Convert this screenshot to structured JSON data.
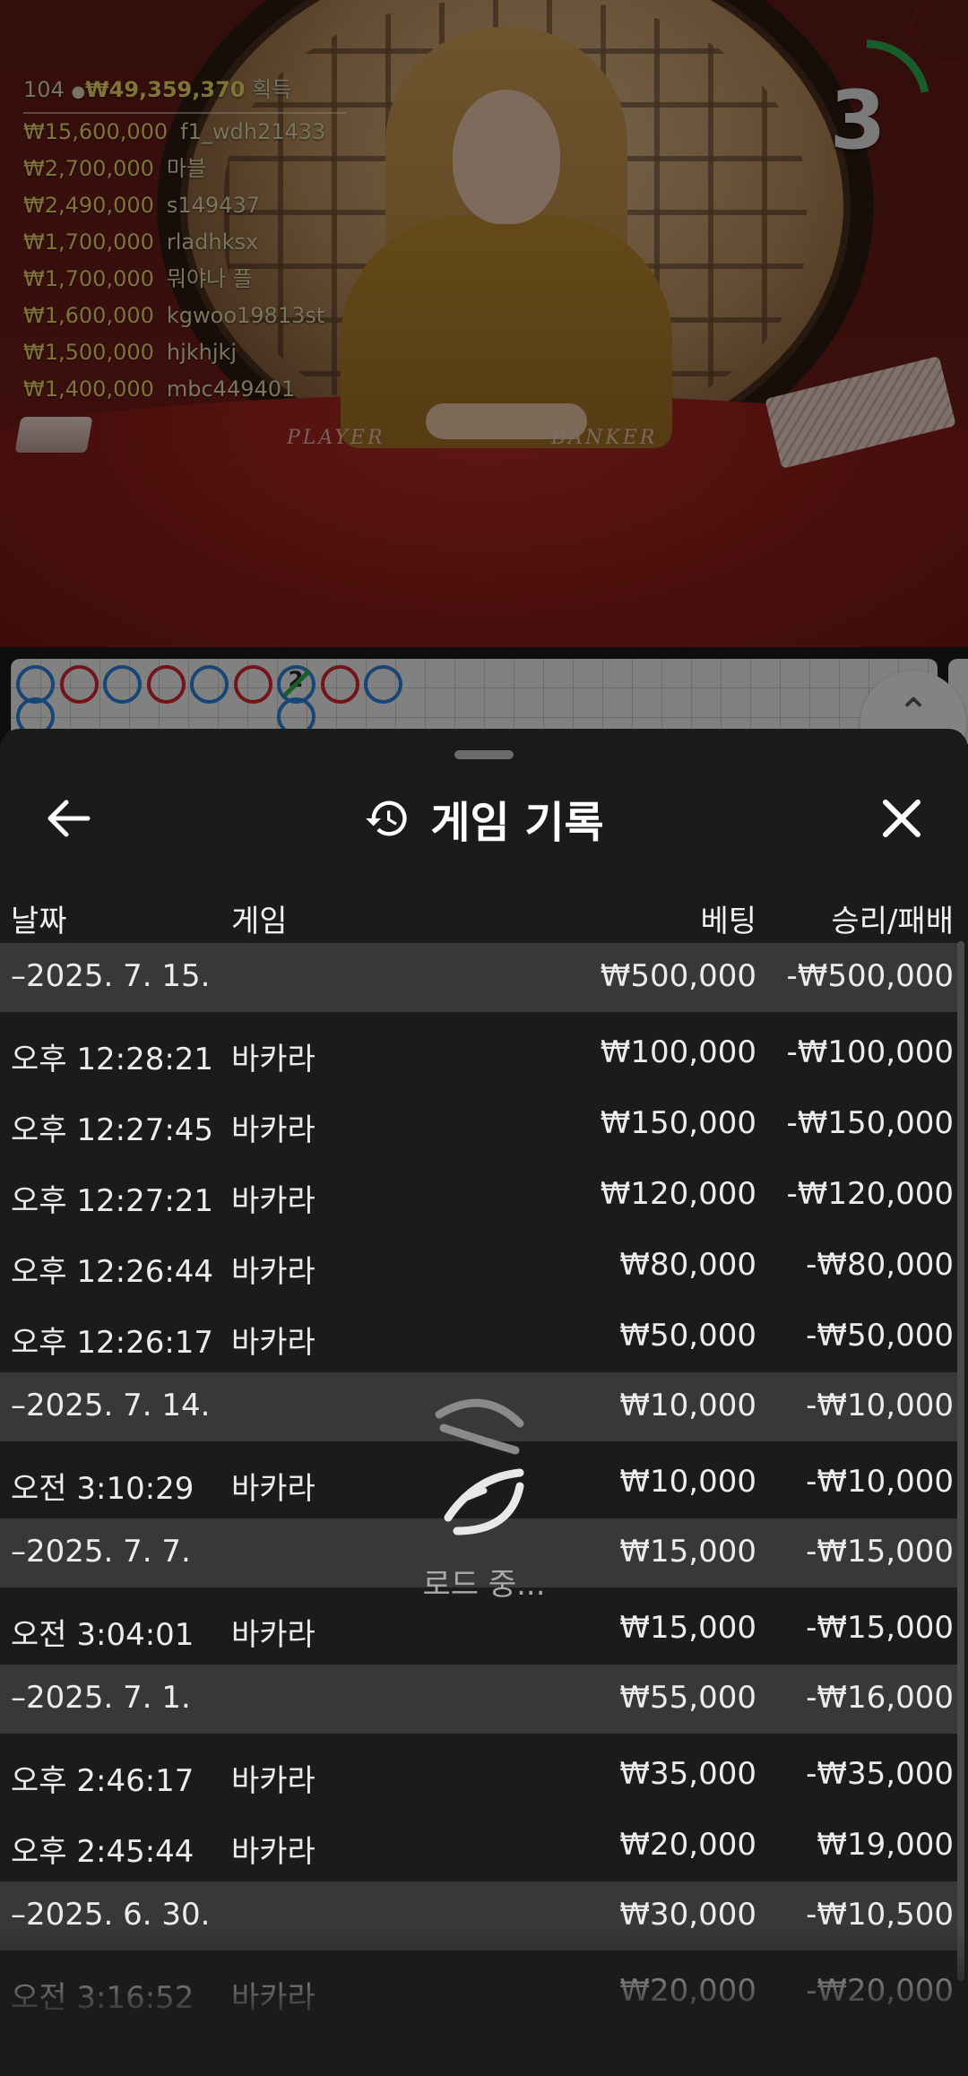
{
  "video": {
    "table_labels": {
      "player": "PLAYER",
      "banker": "BANKER"
    },
    "winners": {
      "count": "104",
      "total": "₩49,359,370",
      "suffix": "획득",
      "list": [
        {
          "amount": "₩15,600,000",
          "name": "f1_wdh21433"
        },
        {
          "amount": "₩2,700,000",
          "name": "마블"
        },
        {
          "amount": "₩2,490,000",
          "name": "s149437"
        },
        {
          "amount": "₩1,700,000",
          "name": "rladhksx"
        },
        {
          "amount": "₩1,700,000",
          "name": "뭐야나 플"
        },
        {
          "amount": "₩1,600,000",
          "name": "kgwoo19813st"
        },
        {
          "amount": "₩1,500,000",
          "name": "hjkhjkj"
        },
        {
          "amount": "₩1,400,000",
          "name": "mbc449401"
        }
      ]
    },
    "countdown": {
      "value": "3",
      "progress": 0.22,
      "color": "#2fa84f"
    }
  },
  "roadmap": {
    "colors": {
      "player": "#2a7fd6",
      "banker": "#d0262c"
    },
    "beads": [
      {
        "col": 0,
        "row": 0,
        "color": "blue"
      },
      {
        "col": 0,
        "row": 1,
        "color": "blue"
      },
      {
        "col": 1,
        "row": 0,
        "color": "red"
      },
      {
        "col": 2,
        "row": 0,
        "color": "blue"
      },
      {
        "col": 3,
        "row": 0,
        "color": "red"
      },
      {
        "col": 4,
        "row": 0,
        "color": "blue"
      },
      {
        "col": 5,
        "row": 0,
        "color": "red"
      },
      {
        "col": 6,
        "row": 0,
        "color": "blue",
        "mark": "2"
      },
      {
        "col": 6,
        "row": 1,
        "color": "blue"
      },
      {
        "col": 7,
        "row": 0,
        "color": "red"
      },
      {
        "col": 8,
        "row": 0,
        "color": "blue"
      }
    ],
    "expand_icon": "chevron-up-icon"
  },
  "history": {
    "title": "게임 기록",
    "icons": {
      "back": "arrow-left-icon",
      "title": "history-icon",
      "close": "close-icon"
    },
    "columns": {
      "date": "날짜",
      "game": "게임",
      "bet": "베팅",
      "result": "승리/패배"
    },
    "groups": [
      {
        "date": "–2025. 7. 15.",
        "bet": "₩500,000",
        "result": "-₩500,000",
        "items": [
          {
            "time": "오후 12:28:21",
            "game": "바카라",
            "bet": "₩100,000",
            "result": "-₩100,000"
          },
          {
            "time": "오후 12:27:45",
            "game": "바카라",
            "bet": "₩150,000",
            "result": "-₩150,000"
          },
          {
            "time": "오후 12:27:21",
            "game": "바카라",
            "bet": "₩120,000",
            "result": "-₩120,000"
          },
          {
            "time": "오후 12:26:44",
            "game": "바카라",
            "bet": "₩80,000",
            "result": "-₩80,000"
          },
          {
            "time": "오후 12:26:17",
            "game": "바카라",
            "bet": "₩50,000",
            "result": "-₩50,000"
          }
        ]
      },
      {
        "date": "–2025. 7. 14.",
        "bet": "₩10,000",
        "result": "-₩10,000",
        "items": [
          {
            "time": "오전 3:10:29",
            "game": "바카라",
            "bet": "₩10,000",
            "result": "-₩10,000"
          }
        ]
      },
      {
        "date": "–2025. 7. 7.",
        "bet": "₩15,000",
        "result": "-₩15,000",
        "items": [
          {
            "time": "오전 3:04:01",
            "game": "바카라",
            "bet": "₩15,000",
            "result": "-₩15,000"
          }
        ]
      },
      {
        "date": "–2025. 7. 1.",
        "bet": "₩55,000",
        "result": "-₩16,000",
        "items": [
          {
            "time": "오후 2:46:17",
            "game": "바카라",
            "bet": "₩35,000",
            "result": "-₩35,000"
          },
          {
            "time": "오후 2:45:44",
            "game": "바카라",
            "bet": "₩20,000",
            "result": "₩19,000"
          }
        ]
      },
      {
        "date": "–2025. 6. 30.",
        "bet": "₩30,000",
        "result": "-₩10,500",
        "items": [
          {
            "time": "오전 3:16:52",
            "game": "바카라",
            "bet": "₩20,000",
            "result": "-₩20,000"
          }
        ]
      }
    ],
    "loading_text": "로드 중..."
  }
}
